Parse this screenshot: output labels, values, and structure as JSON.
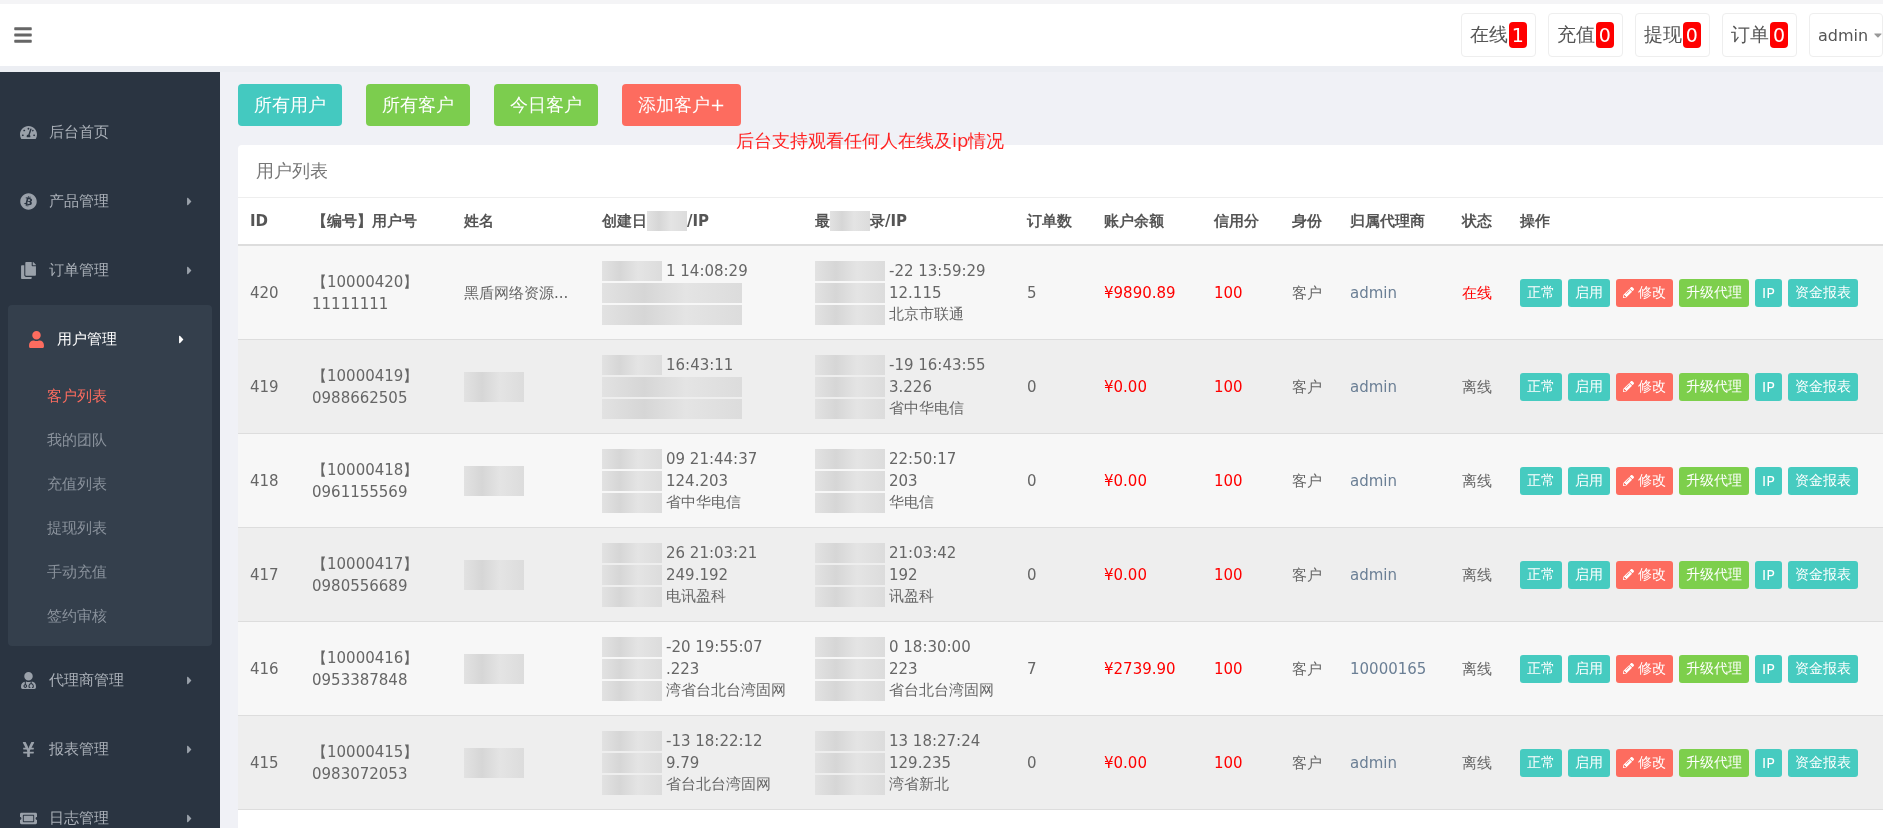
{
  "topbar": {
    "badges": [
      {
        "label": "在线",
        "count": "1"
      },
      {
        "label": "充值",
        "count": "0"
      },
      {
        "label": "提现",
        "count": "0"
      },
      {
        "label": "订单",
        "count": "0"
      }
    ],
    "user": "admin"
  },
  "sidebar": {
    "items": [
      {
        "label": "后台首页",
        "kind": "dashboard",
        "expandable": false,
        "expanded": false
      },
      {
        "label": "产品管理",
        "kind": "bitcoin",
        "expandable": true,
        "expanded": false
      },
      {
        "label": "订单管理",
        "kind": "copy",
        "expandable": true,
        "expanded": false
      },
      {
        "label": "用户管理",
        "kind": "user",
        "expandable": true,
        "expanded": true,
        "children": [
          {
            "label": "客户列表",
            "selected": true
          },
          {
            "label": "我的团队",
            "selected": false
          },
          {
            "label": "充值列表",
            "selected": false
          },
          {
            "label": "提现列表",
            "selected": false
          },
          {
            "label": "手动充值",
            "selected": false
          },
          {
            "label": "签约审核",
            "selected": false
          }
        ]
      },
      {
        "label": "代理商管理",
        "kind": "agent",
        "expandable": true,
        "expanded": false
      },
      {
        "label": "报表管理",
        "kind": "yen",
        "expandable": true,
        "expanded": false
      },
      {
        "label": "日志管理",
        "kind": "ticket",
        "expandable": true,
        "expanded": false
      }
    ]
  },
  "actions": [
    {
      "label": "所有用户",
      "color": "#44c9c0"
    },
    {
      "label": "所有客户",
      "color": "#7ccd4e"
    },
    {
      "label": "今日客户",
      "color": "#7ccd4e"
    },
    {
      "label": "添加客户+",
      "color": "#fd6c5f"
    }
  ],
  "note": "后台支持观看任何人在线及ip情况",
  "panel": {
    "title": "用户列表",
    "columns": [
      {
        "label": "ID"
      },
      {
        "label": "【编号】用户号"
      },
      {
        "label": "姓名"
      },
      {
        "label": "创建日",
        "after": "/IP"
      },
      {
        "label": "最",
        "after": "录/IP"
      },
      {
        "label": "订单数"
      },
      {
        "label": "账户余额"
      },
      {
        "label": "信用分"
      },
      {
        "label": "身份"
      },
      {
        "label": "归属代理商"
      },
      {
        "label": "状态"
      },
      {
        "label": "操作"
      }
    ],
    "rows": [
      {
        "id": "420",
        "code": "【10000420】",
        "user_no": "11111111",
        "name": "黑盾网络资源...",
        "created": [
          {
            "text": "1 14:08:29"
          },
          {
            "kind": "hidden"
          },
          {
            "kind": "hidden"
          }
        ],
        "last_login": [
          {
            "text": "-22 13:59:29"
          },
          {
            "text": "12.115"
          },
          {
            "text": "北京市联通"
          }
        ],
        "orders": "5",
        "balance": "¥9890.89",
        "credit": "100",
        "role": "客户",
        "agent": "admin",
        "status": "在线",
        "online": true,
        "buttons": [
          {
            "label": "正常",
            "kind": "teal"
          },
          {
            "label": "启用",
            "kind": "teal"
          },
          {
            "label": "修改",
            "kind": "edit"
          },
          {
            "label": "升级代理",
            "kind": "green"
          },
          {
            "label": "IP",
            "kind": "teal"
          },
          {
            "label": "资金报表",
            "kind": "teal"
          }
        ]
      },
      {
        "id": "419",
        "code": "【10000419】",
        "user_no": "0988662505",
        "created": [
          {
            "text": "16:43:11"
          },
          {
            "kind": "hidden"
          },
          {
            "kind": "hidden"
          }
        ],
        "last_login": [
          {
            "text": "-19 16:43:55"
          },
          {
            "text": "3.226"
          },
          {
            "text": "省中华电信"
          }
        ],
        "orders": "0",
        "balance": "¥0.00",
        "credit": "100",
        "role": "客户",
        "agent": "admin",
        "status": "离线",
        "online": false,
        "buttons": [
          {
            "label": "正常",
            "kind": "teal"
          },
          {
            "label": "启用",
            "kind": "teal"
          },
          {
            "label": "修改",
            "kind": "edit"
          },
          {
            "label": "升级代理",
            "kind": "green"
          },
          {
            "label": "IP",
            "kind": "teal"
          },
          {
            "label": "资金报表",
            "kind": "teal"
          }
        ]
      },
      {
        "id": "418",
        "code": "【10000418】",
        "user_no": "0961155569",
        "created": [
          {
            "text": "09 21:44:37"
          },
          {
            "text": "124.203"
          },
          {
            "text": "省中华电信"
          }
        ],
        "last_login": [
          {
            "text": "22:50:17"
          },
          {
            "text": "203"
          },
          {
            "text": "华电信"
          }
        ],
        "orders": "0",
        "balance": "¥0.00",
        "credit": "100",
        "role": "客户",
        "agent": "admin",
        "status": "离线",
        "online": false,
        "buttons": [
          {
            "label": "正常",
            "kind": "teal"
          },
          {
            "label": "启用",
            "kind": "teal"
          },
          {
            "label": "修改",
            "kind": "edit"
          },
          {
            "label": "升级代理",
            "kind": "green"
          },
          {
            "label": "IP",
            "kind": "teal"
          },
          {
            "label": "资金报表",
            "kind": "teal"
          }
        ]
      },
      {
        "id": "417",
        "code": "【10000417】",
        "user_no": "0980556689",
        "created": [
          {
            "text": "26 21:03:21"
          },
          {
            "text": "249.192"
          },
          {
            "text": "电讯盈科"
          }
        ],
        "last_login": [
          {
            "text": "21:03:42"
          },
          {
            "text": "192"
          },
          {
            "text": "讯盈科"
          }
        ],
        "orders": "0",
        "balance": "¥0.00",
        "credit": "100",
        "role": "客户",
        "agent": "admin",
        "status": "离线",
        "online": false,
        "buttons": [
          {
            "label": "正常",
            "kind": "teal"
          },
          {
            "label": "启用",
            "kind": "teal"
          },
          {
            "label": "修改",
            "kind": "edit"
          },
          {
            "label": "升级代理",
            "kind": "green"
          },
          {
            "label": "IP",
            "kind": "teal"
          },
          {
            "label": "资金报表",
            "kind": "teal"
          }
        ]
      },
      {
        "id": "416",
        "code": "【10000416】",
        "user_no": "0953387848",
        "created": [
          {
            "text": "-20 19:55:07"
          },
          {
            "text": ".223"
          },
          {
            "text": "湾省台北台湾固网"
          }
        ],
        "last_login": [
          {
            "text": "0 18:30:00"
          },
          {
            "text": "223"
          },
          {
            "text": "省台北台湾固网"
          }
        ],
        "orders": "7",
        "balance": "¥2739.90",
        "credit": "100",
        "role": "客户",
        "agent": "10000165",
        "status": "离线",
        "online": false,
        "buttons": [
          {
            "label": "正常",
            "kind": "teal"
          },
          {
            "label": "启用",
            "kind": "teal"
          },
          {
            "label": "修改",
            "kind": "edit"
          },
          {
            "label": "升级代理",
            "kind": "green"
          },
          {
            "label": "IP",
            "kind": "teal"
          },
          {
            "label": "资金报表",
            "kind": "teal"
          }
        ]
      },
      {
        "id": "415",
        "code": "【10000415】",
        "user_no": "0983072053",
        "created": [
          {
            "text": "-13 18:22:12"
          },
          {
            "text": "9.79"
          },
          {
            "text": "省台北台湾固网"
          }
        ],
        "last_login": [
          {
            "text": "13 18:27:24"
          },
          {
            "text": "129.235"
          },
          {
            "text": "湾省新北"
          }
        ],
        "orders": "0",
        "balance": "¥0.00",
        "credit": "100",
        "role": "客户",
        "agent": "admin",
        "status": "离线",
        "online": false,
        "buttons": [
          {
            "label": "正常",
            "kind": "teal"
          },
          {
            "label": "启用",
            "kind": "teal"
          },
          {
            "label": "修改",
            "kind": "edit"
          },
          {
            "label": "升级代理",
            "kind": "green"
          },
          {
            "label": "IP",
            "kind": "teal"
          },
          {
            "label": "资金报表",
            "kind": "teal"
          }
        ]
      }
    ]
  }
}
